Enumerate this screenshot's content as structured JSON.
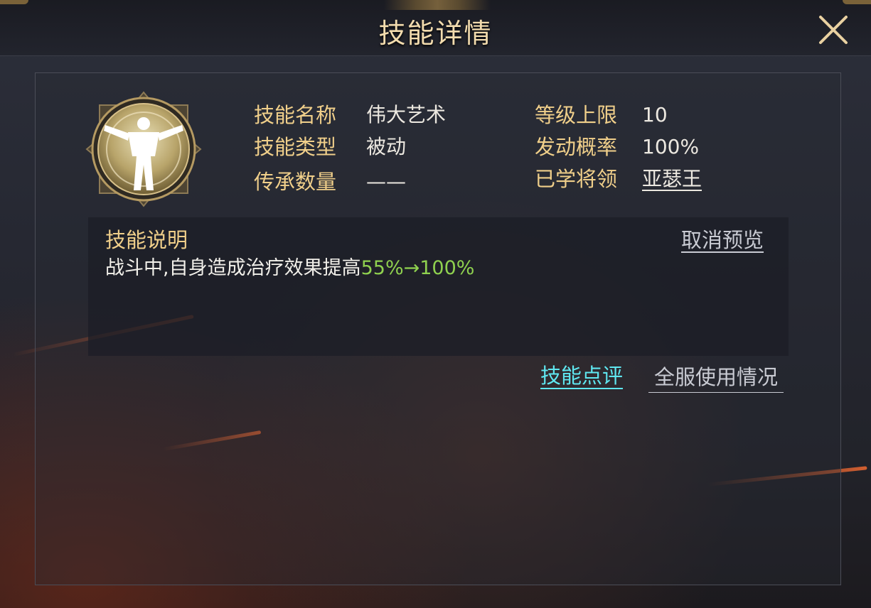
{
  "header": {
    "title": "技能详情",
    "close_icon": "close-icon"
  },
  "skill": {
    "emblem_icon": "figure-emblem-icon",
    "name_label": "技能名称",
    "name_value": "伟大艺术",
    "type_label": "技能类型",
    "type_value": "被动",
    "inherit_label": "传承数量",
    "inherit_value": "——",
    "level_label": "等级上限",
    "level_value": "10",
    "chance_label": "发动概率",
    "chance_value": "100%",
    "learned_label": "已学将领",
    "learned_value": "亚瑟王"
  },
  "description": {
    "title": "技能说明",
    "cancel_preview": "取消预览",
    "text_prefix": "战斗中,自身造成治疗效果提高",
    "text_highlight": "55%→100%"
  },
  "links": {
    "review": "技能点评",
    "usage": "全服使用情况"
  },
  "colors": {
    "title_gold": "#f3dcae",
    "label_gold": "#f0cf8a",
    "highlight_green": "#8fd14f",
    "link_cyan": "#5fe7f0"
  }
}
